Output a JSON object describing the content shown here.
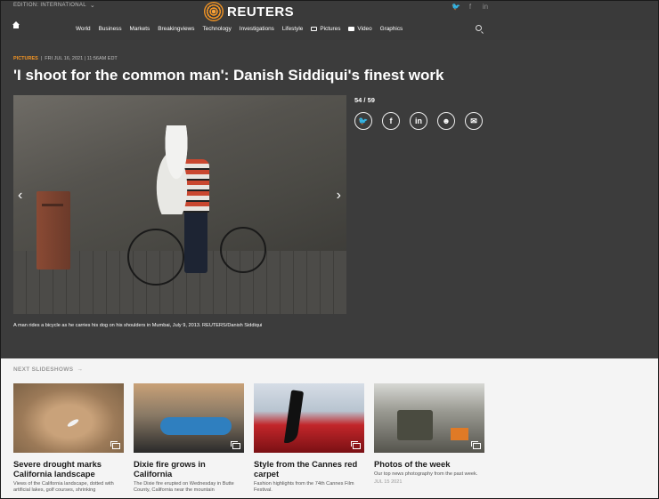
{
  "header": {
    "edition": "EDITION: INTERNATIONAL",
    "logo": "REUTERS",
    "social": [
      "twitter-icon",
      "facebook-icon",
      "linkedin-icon"
    ]
  },
  "nav": {
    "items": [
      "World",
      "Business",
      "Markets",
      "Breakingviews",
      "Technology",
      "Investigations",
      "Lifestyle",
      "Pictures",
      "Video",
      "Graphics"
    ]
  },
  "article": {
    "section": "PICTURES",
    "datetime": "FRI JUL 16, 2021 | 11:56AM EDT",
    "headline": "'I shoot for the common man': Danish Siddiqui's finest work",
    "counter": "54 / 59",
    "caption": "A man rides a bicycle as he carries his dog on his shoulders in Mumbai, July 9, 2013. REUTERS/Danish Siddiqui"
  },
  "share": [
    "twitter",
    "facebook",
    "linkedin",
    "reddit",
    "email"
  ],
  "next": {
    "label": "NEXT SLIDESHOWS",
    "cards": [
      {
        "title": "Severe drought marks California landscape",
        "desc": "Views of the California landscape, dotted with artificial lakes, golf courses, shrinking",
        "date": ""
      },
      {
        "title": "Dixie fire grows in California",
        "desc": "The Dixie fire erupted on Wednesday in Butte County, California near the mountain",
        "date": ""
      },
      {
        "title": "Style from the Cannes red carpet",
        "desc": "Fashion highlights from the 74th Cannes Film Festival.",
        "date": ""
      },
      {
        "title": "Photos of the week",
        "desc": "Our top news photography from the past week.",
        "date": "JUL 15 2021"
      }
    ]
  },
  "colors": {
    "accent": "#f29424",
    "dark_bg": "#3c3c3c",
    "light_bg": "#f4f4f4"
  }
}
